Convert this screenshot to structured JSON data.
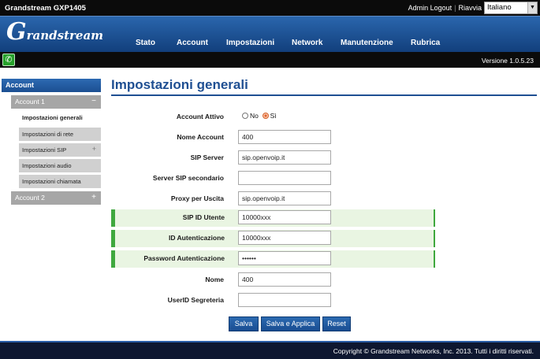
{
  "topbar": {
    "model": "Grandstream GXP1405",
    "admin_logout": "Admin Logout",
    "reboot": "Riavvia",
    "separator": "|",
    "language": "Italiano"
  },
  "logo": {
    "initial": "G",
    "text": "randstream"
  },
  "nav": [
    "Stato",
    "Account",
    "Impostazioni",
    "Network",
    "Manutenzione",
    "Rubrica"
  ],
  "version": "Versione 1.0.5.23",
  "sidebar": {
    "account": "Account",
    "account1": "Account 1",
    "account1_symbol": "−",
    "items": [
      {
        "label": "Impostazioni generali",
        "symbol": ""
      },
      {
        "label": "Impostazioni di rete",
        "symbol": ""
      },
      {
        "label": "Impostazioni SIP",
        "symbol": "+"
      },
      {
        "label": "Impostazioni audio",
        "symbol": ""
      },
      {
        "label": "Impostazioni chiamata",
        "symbol": ""
      }
    ],
    "account2": "Account 2",
    "account2_symbol": "+"
  },
  "page": {
    "title": "Impostazioni generali"
  },
  "form": {
    "account_active": {
      "label": "Account Attivo",
      "no": "No",
      "yes": "Sì",
      "selected": "Sì"
    },
    "fields": [
      {
        "label": "Nome Account",
        "value": "400",
        "highlight": false
      },
      {
        "label": "SIP Server",
        "value": "sip.openvoip.it",
        "highlight": false
      },
      {
        "label": "Server SIP secondario",
        "value": "",
        "highlight": false
      },
      {
        "label": "Proxy per Uscita",
        "value": "sip.openvoip.it",
        "highlight": false
      },
      {
        "label": "SIP ID Utente",
        "value": "10000xxx",
        "highlight": true
      },
      {
        "label": "ID Autenticazione",
        "value": "10000xxx",
        "highlight": true
      },
      {
        "label": "Password Autenticazione",
        "value": "••••••",
        "highlight": true
      },
      {
        "label": "Nome",
        "value": "400",
        "highlight": false
      },
      {
        "label": "UserID Segreteria",
        "value": "",
        "highlight": false
      }
    ]
  },
  "buttons": {
    "save": "Salva",
    "save_apply": "Salva e Applica",
    "reset": "Reset"
  },
  "footer": "Copyright © Grandstream Networks, Inc. 2013. Tutti i diritti riservati.",
  "colors": {
    "brand_blue": "#1f4f92",
    "highlight_green": "#3fa83e",
    "radio_selected": "#e5602a"
  }
}
